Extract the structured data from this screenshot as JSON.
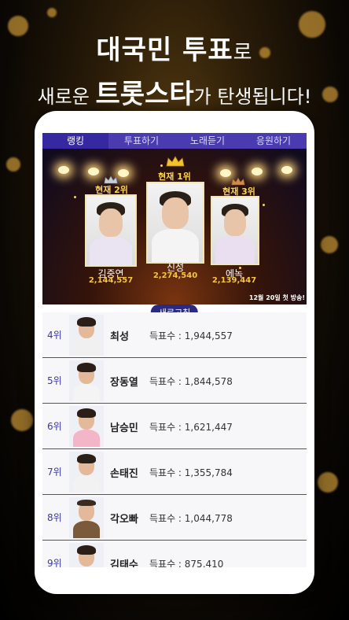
{
  "headline": {
    "line1_main": "대국민 투표",
    "line1_suffix": "로",
    "line2_prefix": "새로운 ",
    "line2_big": "트롯스타",
    "line2_suffix": "가 탄생됩니다!"
  },
  "tabs": [
    {
      "label": "랭킹",
      "active": true
    },
    {
      "label": "투표하기",
      "active": false
    },
    {
      "label": "노래듣기",
      "active": false
    },
    {
      "label": "응원하기",
      "active": false
    }
  ],
  "top3": [
    {
      "label": "현재 1위",
      "name": "신성",
      "votes": "2,274,540"
    },
    {
      "label": "현재 2위",
      "name": "김중연",
      "votes": "2,144,557"
    },
    {
      "label": "현재 3위",
      "name": "에녹",
      "votes": "2,139,447"
    }
  ],
  "broadcast_note": "12월 20일 첫 방송!",
  "refresh_label": "새로고침",
  "vote_prefix": "득표수 : ",
  "rankings": [
    {
      "rank": "4위",
      "name": "최성",
      "votes": "득표수 : 1,944,557",
      "outfit": "#f0f0f0"
    },
    {
      "rank": "5위",
      "name": "장동열",
      "votes": "득표수 : 1,844,578",
      "outfit": "#f4f4f4"
    },
    {
      "rank": "6위",
      "name": "남승민",
      "votes": "득표수 : 1,621,447",
      "outfit": "#f3b6c9"
    },
    {
      "rank": "7위",
      "name": "손태진",
      "votes": "득표수 : 1,355,784",
      "outfit": "#f2f2f2"
    },
    {
      "rank": "8위",
      "name": "각오빠",
      "votes": "득표수 : 1,044,778",
      "outfit": "#7a5a3a"
    },
    {
      "rank": "9위",
      "name": "김태수",
      "votes": "득표수 : 875,410",
      "outfit": "#f0f0f0"
    }
  ],
  "colors": {
    "tab_bar": "#4a3bb0",
    "rank_text": "#3a3aa0",
    "votes_gold": "#f5c542",
    "rank_label_gold": "#ffd54a"
  }
}
